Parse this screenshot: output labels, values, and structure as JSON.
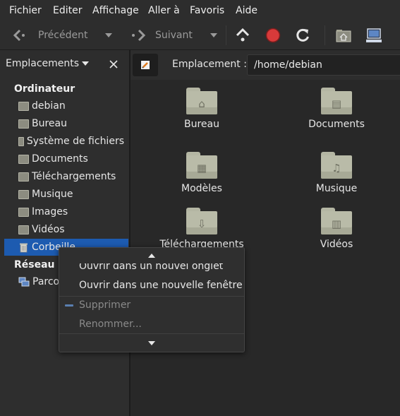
{
  "menubar": {
    "items": [
      "Fichier",
      "Editer",
      "Affichage",
      "Aller à",
      "Favoris",
      "Aide"
    ]
  },
  "toolbar": {
    "back_label": "Précédent",
    "forward_label": "Suivant"
  },
  "locationbar": {
    "label": "Emplacement :",
    "path": "/home/debian"
  },
  "sidebar": {
    "title": "Emplacements",
    "section_computer": "Ordinateur",
    "items": [
      "debian",
      "Bureau",
      "Système de fichiers",
      "Documents",
      "Téléchargements",
      "Musique",
      "Images",
      "Vidéos",
      "Corbeille"
    ],
    "section_network": "Réseau",
    "network_items": [
      "Parco"
    ]
  },
  "main": {
    "folders": [
      "Bureau",
      "Documents",
      "Modèles",
      "Musique",
      "Téléchargements",
      "Vidéos"
    ]
  },
  "context_menu": {
    "items": [
      "Ouvrir dans un nouvel onglet",
      "Ouvrir dans une nouvelle fenêtre",
      "Supprimer",
      "Renommer..."
    ]
  },
  "colors": {
    "selection": "#1d5bb0",
    "stop": "#d83a3a",
    "background": "#282828"
  }
}
